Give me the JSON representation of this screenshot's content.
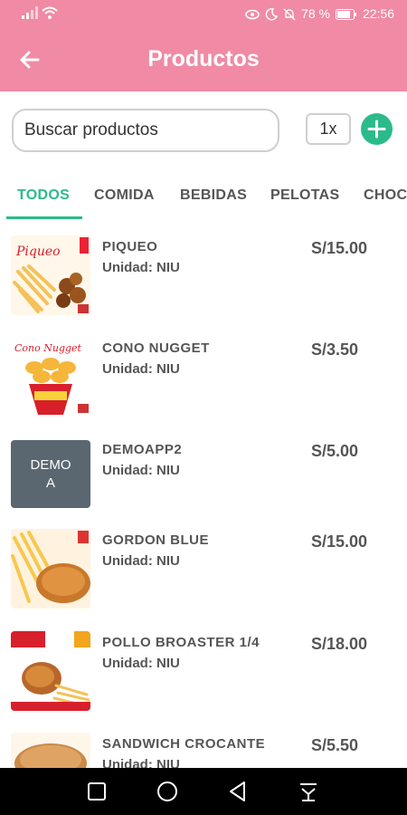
{
  "status_bar": {
    "battery": "78 %",
    "time": "22:56",
    "icons": [
      "signal-icon",
      "wifi-icon",
      "eye-icon",
      "moon-icon",
      "bell-off-icon",
      "battery-icon"
    ]
  },
  "header": {
    "title": "Productos",
    "back_icon": "arrow-left-icon",
    "color": "#f08aa5"
  },
  "search": {
    "placeholder": "Buscar productos",
    "quantity": "1x",
    "add_icon": "plus-icon"
  },
  "accent": "#2bbb8a",
  "tabs": [
    {
      "label": "TODOS",
      "active": true
    },
    {
      "label": "COMIDA"
    },
    {
      "label": "BEBIDAS"
    },
    {
      "label": "PELOTAS"
    },
    {
      "label": "CHOC"
    }
  ],
  "products": [
    {
      "name": "PIQUEO",
      "unit": "Unidad: NIU",
      "price": "S/15.00",
      "image": "piqueo-photo"
    },
    {
      "name": "CONO NUGGET",
      "unit": "Unidad: NIU",
      "price": "S/3.50",
      "image": "cono-nugget-photo"
    },
    {
      "name": "DEMOAPP2",
      "unit": "Unidad: NIU",
      "price": "S/5.00",
      "image_text": "DEMO\nA"
    },
    {
      "name": "GORDON BLUE",
      "unit": "Unidad: NIU",
      "price": "S/15.00",
      "image": "gordon-blue-photo"
    },
    {
      "name": "POLLO BROASTER 1/4",
      "unit": "Unidad: NIU",
      "price": "S/18.00",
      "image": "pollo-broaster-photo"
    },
    {
      "name": "SANDWICH CROCANTE",
      "unit": "Unidad: NIU",
      "price": "S/5.50",
      "image": "sandwich-photo"
    }
  ],
  "image_texts": {
    "piqueo": "Piqueo",
    "cono": "Cono Nugget"
  },
  "nav_bar": [
    "recents-icon",
    "home-icon",
    "back-icon",
    "notifications-icon"
  ]
}
